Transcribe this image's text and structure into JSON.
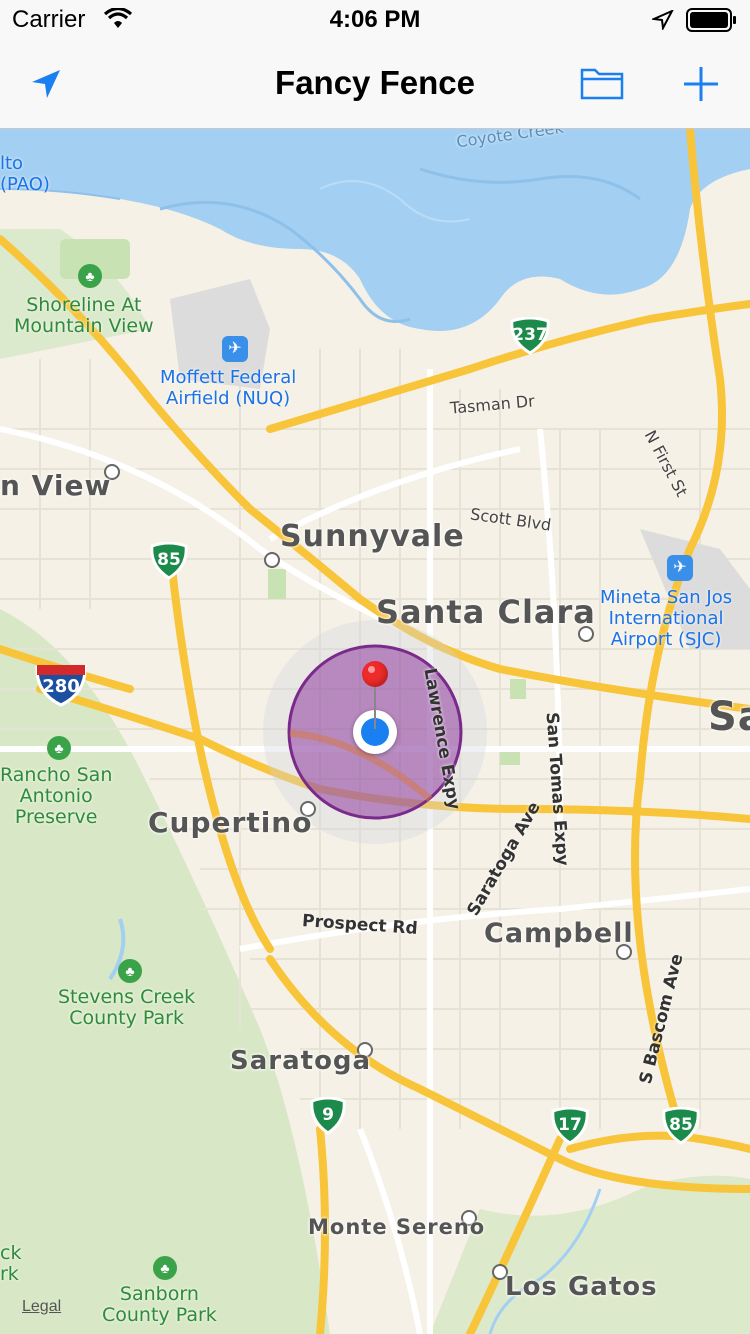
{
  "status_bar": {
    "carrier": "Carrier",
    "time": "4:06 PM"
  },
  "nav": {
    "title": "Fancy Fence"
  },
  "map": {
    "cities": {
      "mountain_view": "n View",
      "sunnyvale": "Sunnyvale",
      "santa_clara": "Santa Clara",
      "cupertino": "Cupertino",
      "campbell": "Campbell",
      "saratoga": "Saratoga",
      "monte_sereno": "Monte Sereno",
      "los_gatos": "Los Gatos",
      "san_jose_partial": "Sa"
    },
    "parks": {
      "shoreline": "Shoreline At\nMountain View",
      "rancho": "Rancho San\nAntonio\nPreserve",
      "stevens": "Stevens Creek\nCounty Park",
      "sanborn": "Sanborn\nCounty Park",
      "edge_left": "ck\nrk"
    },
    "airports": {
      "palo_alto": "lto\n(PAO)",
      "moffett": "Moffett Federal\nAirfield (NUQ)",
      "sjc": "Mineta San Jos\nInternational\nAirport (SJC)"
    },
    "roads": {
      "coyote": "Coyote Creek",
      "tasman": "Tasman Dr",
      "first": "N First St",
      "scott": "Scott Blvd",
      "lawrence": "Lawrence Expy",
      "san_tomas": "San Tomas Expy",
      "saratoga_ave": "Saratoga Ave",
      "prospect": "Prospect Rd",
      "bascom": "S Bascom Ave"
    },
    "shields": {
      "s237": "237",
      "s85a": "85",
      "s280": "280",
      "s9": "9",
      "s17": "17",
      "s85b": "85"
    },
    "legal": "Legal",
    "colors": {
      "water": "#a3cff2",
      "freeway": "#f8c43a",
      "fence": "#8e3d9e",
      "user": "#1a7ff0",
      "pin": "#ee2a2a"
    }
  }
}
